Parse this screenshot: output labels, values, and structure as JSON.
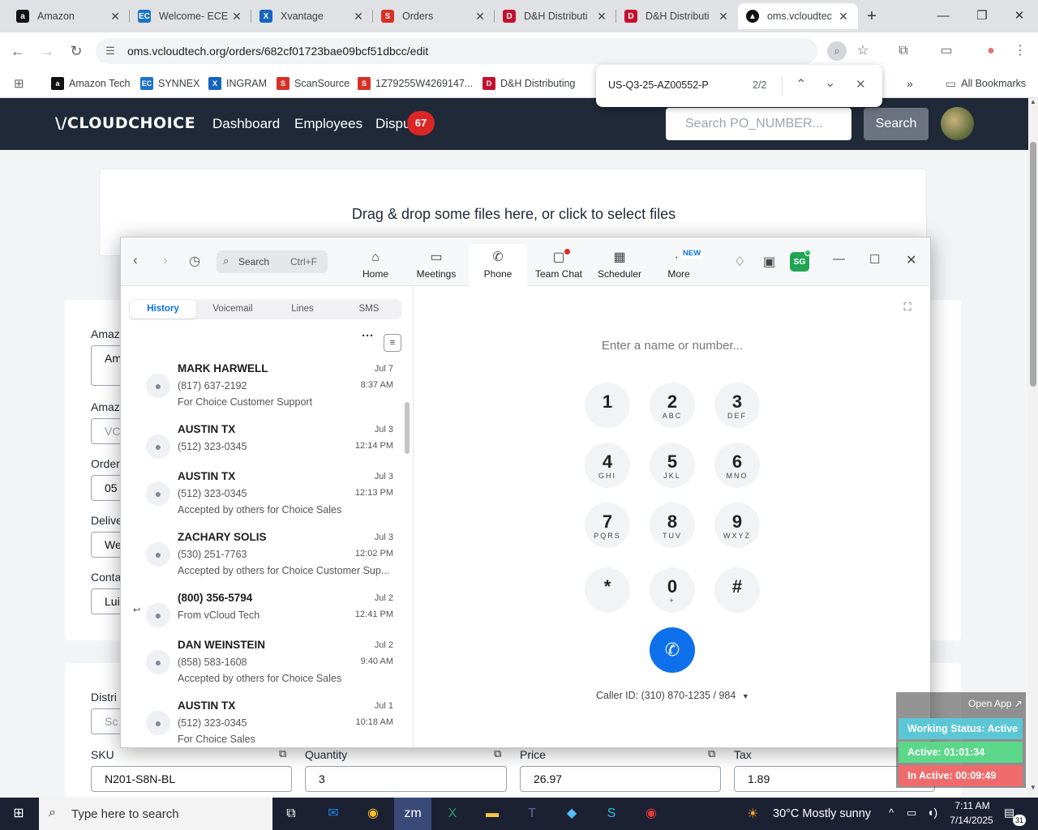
{
  "browser": {
    "tabs": [
      {
        "title": "Amazon",
        "icon": "amazon-icon",
        "color": "#111111"
      },
      {
        "title": "Welcome- ECE",
        "icon": "ec-icon",
        "color": "#1a73c9"
      },
      {
        "title": "Xvantage",
        "icon": "xvantage-icon",
        "color": "#1565c0"
      },
      {
        "title": "Orders",
        "icon": "scansource-icon",
        "color": "#d93025"
      },
      {
        "title": "D&H Distributi",
        "icon": "dh-icon",
        "color": "#c4102e"
      },
      {
        "title": "D&H Distributi",
        "icon": "dh-icon",
        "color": "#c4102e"
      },
      {
        "title": "oms.vcloudtec",
        "icon": "vcloud-icon",
        "color": "#111111"
      }
    ],
    "url": "oms.vcloudtech.org/orders/682cf01723bae09bcf51dbcc/edit",
    "bookmarks": [
      {
        "label": "Amazon Tech",
        "color": "#111111"
      },
      {
        "label": "SYNNEX",
        "color": "#1a73c9"
      },
      {
        "label": "INGRAM",
        "color": "#1565c0"
      },
      {
        "label": "ScanSource",
        "color": "#d93025"
      },
      {
        "label": "1Z79255W4269147...",
        "color": "#d93025"
      },
      {
        "label": "D&H Distributing",
        "color": "#c4102e"
      }
    ],
    "all_bookmarks": "All Bookmarks",
    "find": {
      "query": "US-Q3-25-AZ00552-P",
      "count": "2/2"
    }
  },
  "app": {
    "logo": "\\/CLOUDCHOICE",
    "nav": {
      "dashboard": "Dashboard",
      "employees": "Employees",
      "disputes": "Dispu",
      "badge": "67"
    },
    "search_placeholder": "Search PO_NUMBER...",
    "search_button": "Search",
    "dropzone": "Drag & drop some files here, or click to select files",
    "fields": {
      "amazon_label_1": "Amaz",
      "amazon_value_1": "Am",
      "amazon_label_2": "Amaz",
      "amazon_value_2": "VC",
      "order_label": "Order",
      "order_value": "05",
      "delivery_label": "Delive",
      "delivery_value": "We",
      "contact_label": "Conta",
      "contact_value": "Lui",
      "distributor_label": "Distri",
      "distributor_value": "Sc"
    },
    "line_item": {
      "sku_label": "SKU",
      "sku": "N201-S8N-BL",
      "qty_label": "Quantity",
      "qty": "3",
      "price_label": "Price",
      "price": "26.97",
      "tax_label": "Tax",
      "tax": "1.89"
    }
  },
  "zoom": {
    "search_label": "Search",
    "search_shortcut": "Ctrl+F",
    "tabs": {
      "home": "Home",
      "meetings": "Meetings",
      "phone": "Phone",
      "team_chat": "Team Chat",
      "scheduler": "Scheduler",
      "more": "More",
      "new_badge": "NEW"
    },
    "avatar_initials": "SG",
    "sub_tabs": {
      "history": "History",
      "voicemail": "Voicemail",
      "lines": "Lines",
      "sms": "SMS"
    },
    "history": [
      {
        "name": "MARK HARWELL",
        "phone": "(817) 637-2192",
        "note": "For Choice Customer Support",
        "date": "Jul 7",
        "time": "8:37 AM"
      },
      {
        "name": "AUSTIN TX",
        "phone": "(512) 323-0345",
        "note": "",
        "date": "Jul 3",
        "time": "12:14 PM"
      },
      {
        "name": "AUSTIN TX",
        "phone": "(512) 323-0345",
        "note": "Accepted by others for Choice Sales",
        "date": "Jul 3",
        "time": "12:13 PM"
      },
      {
        "name": "ZACHARY SOLIS",
        "phone": "(530) 251-7763",
        "note": "Accepted by others for Choice Customer Sup...",
        "date": "Jul 3",
        "time": "12:02 PM"
      },
      {
        "name": "(800) 356-5794",
        "phone": "From vCloud Tech",
        "note": "",
        "date": "Jul 2",
        "time": "12:41 PM"
      },
      {
        "name": "DAN WEINSTEIN",
        "phone": "(858) 583-1608",
        "note": "Accepted by others for Choice Sales",
        "date": "Jul 2",
        "time": "9:40 AM"
      },
      {
        "name": "AUSTIN TX",
        "phone": "(512) 323-0345",
        "note": "For Choice Sales",
        "date": "Jul 1",
        "time": "10:18 AM"
      }
    ],
    "dial_placeholder": "Enter a name or number...",
    "keypad": [
      {
        "digit": "1",
        "letters": ""
      },
      {
        "digit": "2",
        "letters": "ABC"
      },
      {
        "digit": "3",
        "letters": "DEF"
      },
      {
        "digit": "4",
        "letters": "GHI"
      },
      {
        "digit": "5",
        "letters": "JKL"
      },
      {
        "digit": "6",
        "letters": "MNO"
      },
      {
        "digit": "7",
        "letters": "PQRS"
      },
      {
        "digit": "8",
        "letters": "TUV"
      },
      {
        "digit": "9",
        "letters": "WXYZ"
      },
      {
        "digit": "*",
        "letters": ""
      },
      {
        "digit": "0",
        "letters": "+"
      },
      {
        "digit": "#",
        "letters": ""
      }
    ],
    "caller_id": "Caller ID: (310) 870-1235 / 984"
  },
  "status_widget": {
    "open_app": "Open App",
    "working": "Working Status: Active",
    "active": "Active: 01:01:34",
    "inactive": "In Active: 00:09:49"
  },
  "taskbar": {
    "search_placeholder": "Type here to search",
    "weather": "30°C  Mostly sunny",
    "time": "7:11 AM",
    "date": "7/14/2025",
    "notifications": "31"
  }
}
